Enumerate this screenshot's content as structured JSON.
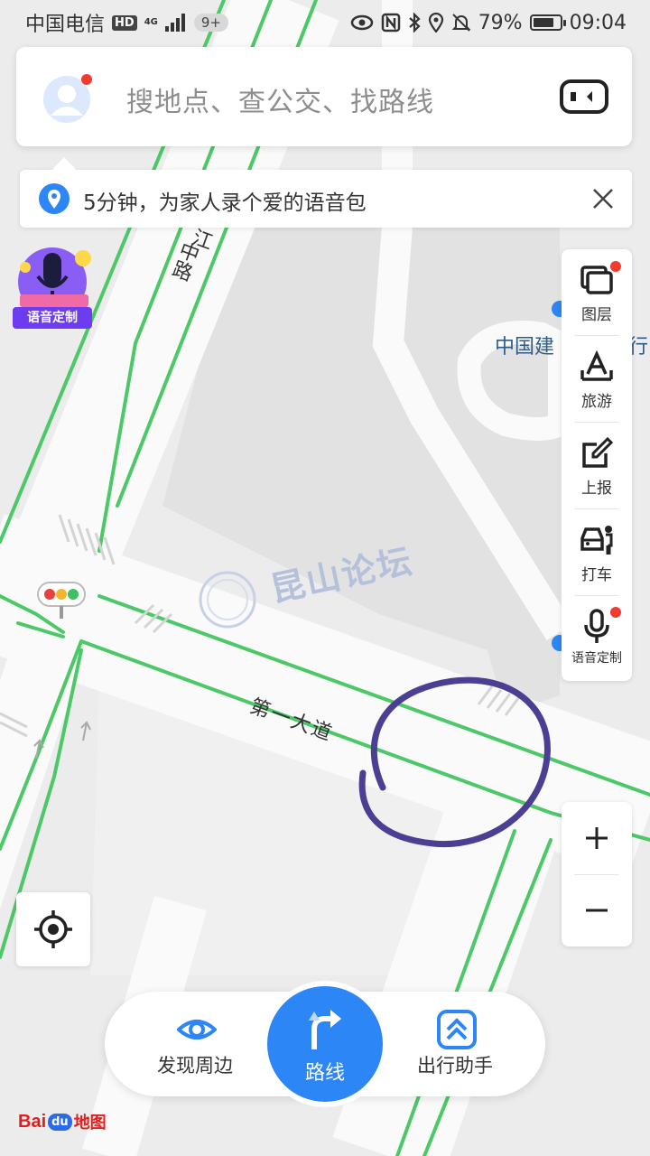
{
  "status_bar": {
    "carrier": "中国电信",
    "hd_badge": "HD",
    "network": "4G",
    "notification_count": "9+",
    "battery_percent": "79%",
    "battery_level": 0.79,
    "time": "09:04",
    "icons": [
      "eye-icon",
      "nfc-icon",
      "bluetooth-icon",
      "location-icon",
      "mute-bell-icon",
      "battery-icon"
    ]
  },
  "search": {
    "placeholder": "搜地点、查公交、找路线",
    "avatar_icon": "avatar-icon",
    "scan_icon": "device-icon"
  },
  "tip": {
    "text": "5分钟，为家人录个爱的语音包",
    "pin_icon": "location-pin-icon",
    "close_icon": "close-icon"
  },
  "voice_badge": {
    "label": "语音定制"
  },
  "map": {
    "road_horizontal": "第一大道",
    "road_vertical": "中路",
    "road_vertical_partial": "江",
    "poi": "中国建",
    "poi_tail": "行",
    "watermark": "昆山论坛"
  },
  "toolbar": {
    "items": [
      {
        "label": "图层",
        "icon": "layers-icon",
        "badge": true
      },
      {
        "label": "旅游",
        "icon": "travel-icon",
        "badge": false
      },
      {
        "label": "上报",
        "icon": "report-icon",
        "badge": false
      },
      {
        "label": "打车",
        "icon": "taxi-icon",
        "badge": false
      },
      {
        "label": "语音定制",
        "icon": "microphone-icon",
        "badge": true
      }
    ]
  },
  "zoom": {
    "in_icon": "plus-icon",
    "out_icon": "minus-icon"
  },
  "locate": {
    "icon": "locate-icon"
  },
  "bottom_bar": {
    "discover": "发现周边",
    "route": "路线",
    "assistant": "出行助手"
  },
  "logo": {
    "bai": "Bai",
    "du": "du",
    "ditu": "地图"
  },
  "colors": {
    "accent_blue": "#2d86f5",
    "road_green": "#4cc867",
    "badge_red": "#f03b30",
    "annotation_purple": "#4b3f94"
  }
}
